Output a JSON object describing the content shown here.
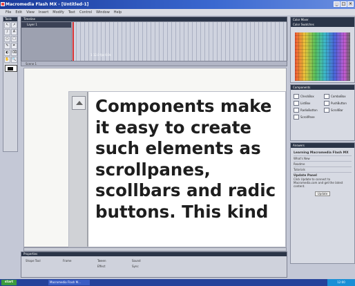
{
  "window": {
    "title": "Macromedia Flash MX - [Untitled-1]"
  },
  "menu": [
    "File",
    "Edit",
    "View",
    "Insert",
    "Modify",
    "Text",
    "Control",
    "Window",
    "Help"
  ],
  "tools": {
    "title": "Tools",
    "items": [
      "↖",
      "↗",
      "/",
      "A",
      "○",
      "□",
      "✎",
      "✒",
      "◐",
      "⌫",
      "✋",
      "🔍"
    ]
  },
  "timeline": {
    "title": "Timeline",
    "layer_name": "Layer 1",
    "status": "1  12.0 fps  0.0s"
  },
  "scene": {
    "label": "Scene 1"
  },
  "stage": {
    "text_lines": [
      "Components make",
      "it easy to create",
      "such elements as",
      "scrollpanes,",
      "scollbars and radic",
      "buttons. This kind"
    ]
  },
  "color_mixer": {
    "title": "Color Mixer",
    "swatches_title": "Color Swatches"
  },
  "components": {
    "title": "Components",
    "items": [
      "CheckBox",
      "ComboBox",
      "ListBox",
      "PushButton",
      "RadioButton",
      "ScrollBar",
      "ScrollPane"
    ]
  },
  "answers": {
    "title": "Answers",
    "heading": "Learning Macromedia Flash MX",
    "rows": [
      "What's New",
      "Readme",
      "Tutorials"
    ],
    "update_heading": "Update Panel",
    "update_text": "Click Update to connect to Macromedia.com and get the latest content.",
    "update_button": "Update"
  },
  "properties": {
    "title": "Properties",
    "fields": [
      "Shape Tool",
      "Frame",
      "Tween",
      "Sound",
      "Effect",
      "Sync"
    ]
  },
  "taskbar": {
    "start": "start",
    "task": "Macromedia Flash M...",
    "tray": "12:00"
  }
}
